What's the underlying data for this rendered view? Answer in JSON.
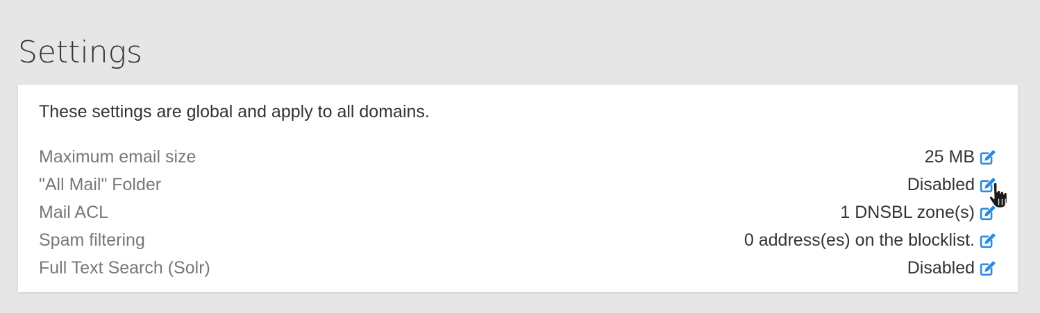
{
  "page": {
    "title": "Settings"
  },
  "card": {
    "intro": "These settings are global and apply to all domains."
  },
  "settings": [
    {
      "label": "Maximum email size",
      "value": "25 MB"
    },
    {
      "label": "\"All Mail\" Folder",
      "value": "Disabled"
    },
    {
      "label": "Mail ACL",
      "value": "1 DNSBL zone(s)"
    },
    {
      "label": "Spam filtering",
      "value": "0 address(es) on the blocklist."
    },
    {
      "label": "Full Text Search (Solr)",
      "value": "Disabled"
    }
  ],
  "icons": {
    "edit": "edit-icon",
    "cursor": "hand-pointer-cursor"
  },
  "colors": {
    "background": "#e6e6e6",
    "card": "#ffffff",
    "accent": "#2a8be0",
    "label": "#777777",
    "text": "#333333"
  }
}
